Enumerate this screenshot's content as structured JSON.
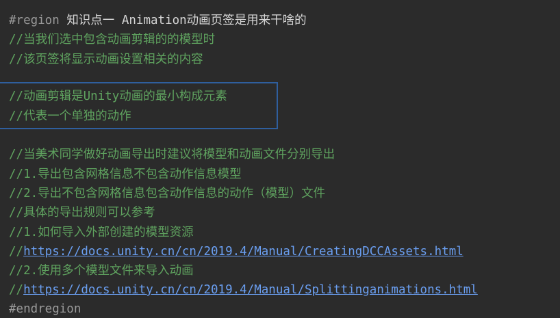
{
  "editor": {
    "region_start_keyword": "#region",
    "region_start_title": "知识点一 Animation动画页签是用来干啥的",
    "comment_prefix": "//",
    "lines": [
      "当我们选中包含动画剪辑的的模型时",
      "该页签将显示动画设置相关的内容",
      "动画剪辑是Unity动画的最小构成元素",
      "代表一个单独的动作",
      "当美术同学做好动画导出时建议将模型和动画文件分别导出",
      "1.导出包含网格信息不包含动作信息模型",
      "2.导出不包含网格信息包含动作信息的动作（模型）文件",
      "具体的导出规则可以参考",
      "1.如何导入外部创建的模型资源",
      "2.使用多个模型文件来导入动画"
    ],
    "links": [
      "https://docs.unity.cn/cn/2019.4/Manual/CreatingDCCAssets.html",
      "https://docs.unity.cn/cn/2019.4/Manual/Splittinganimations.html"
    ],
    "region_end_keyword": "#endregion"
  },
  "colors": {
    "background": "#2b2b2b",
    "comment": "#5fa35f",
    "link": "#6a9ef0",
    "keyword": "#9a9a9a",
    "highlight_border": "#2f5f9e"
  }
}
